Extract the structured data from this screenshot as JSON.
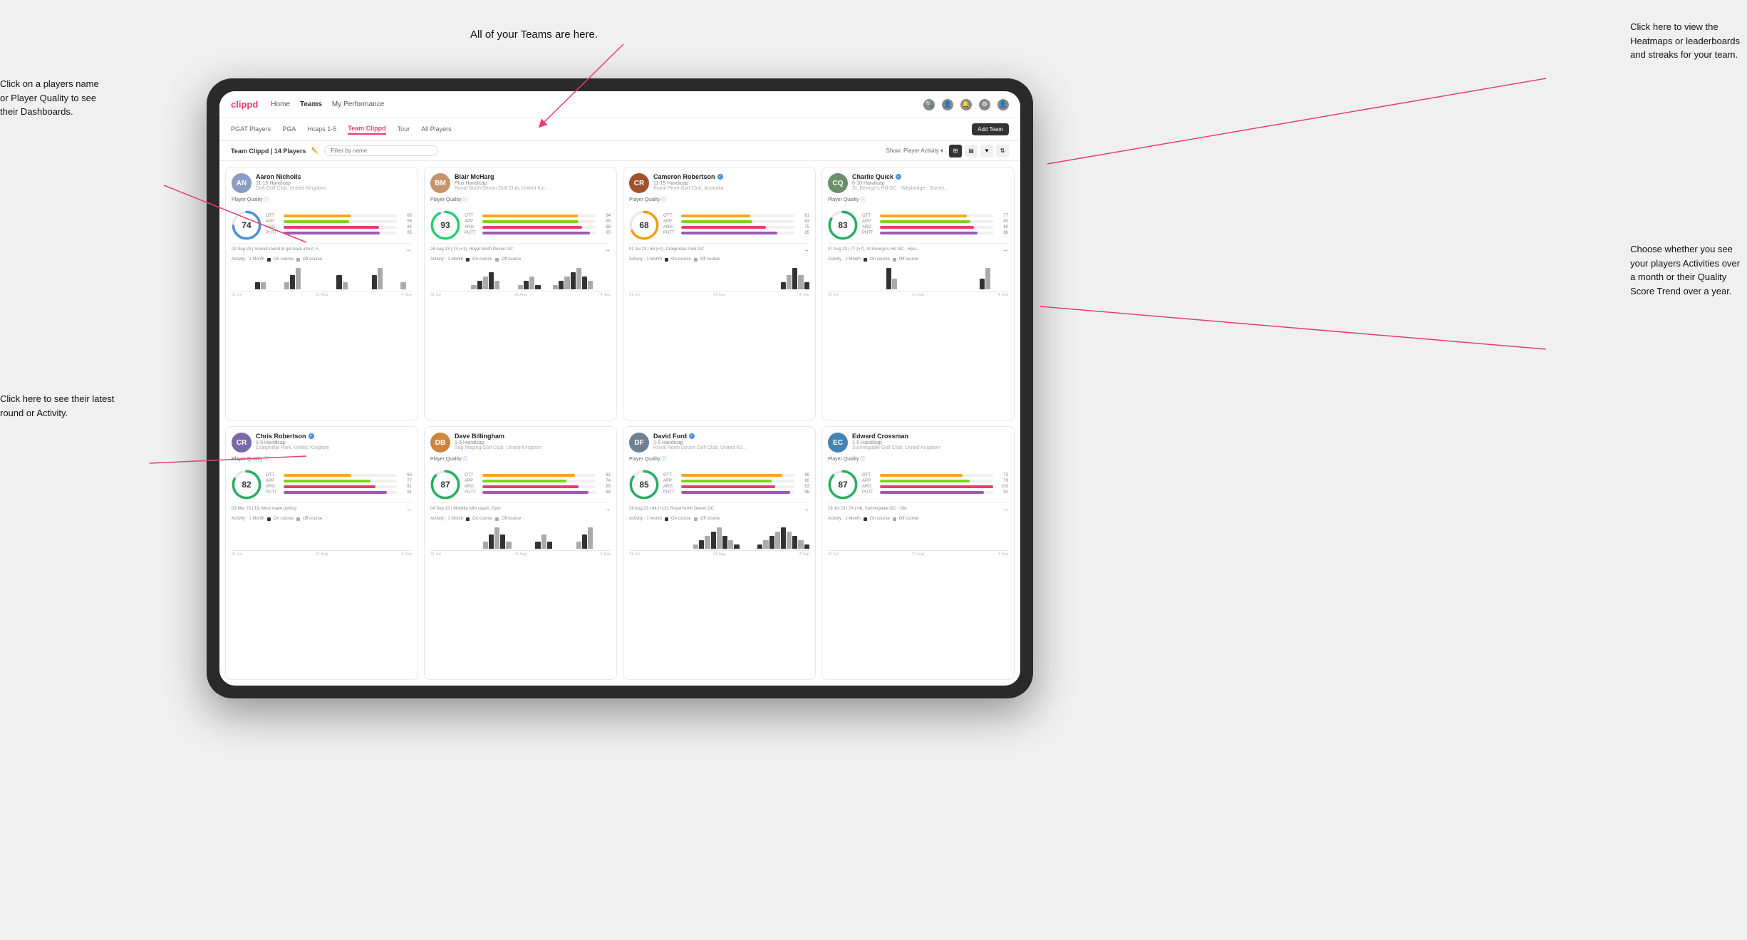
{
  "annotations": {
    "teams_callout": "All of your Teams are here.",
    "heatmaps_callout": "Click here to view the\nHeatmaps or leaderboards\nand streaks for your team.",
    "players_name_callout": "Click on a players name\nor Player Quality to see\ntheir Dashboards.",
    "latest_round_callout": "Click here to see their latest\nround or Activity.",
    "activities_callout": "Choose whether you see\nyour players Activities over\na month or their Quality\nScore Trend over a year."
  },
  "nav": {
    "logo": "clippd",
    "links": [
      "Home",
      "Teams",
      "My Performance"
    ],
    "active_link": "Teams"
  },
  "sub_nav": {
    "links": [
      "PGAT Players",
      "PGA",
      "Hcaps 1-5",
      "Team Clippd",
      "Tour",
      "All Players"
    ],
    "active": "Team Clippd",
    "add_team_label": "Add Team"
  },
  "team_header": {
    "title": "Team Clippd | 14 Players",
    "filter_placeholder": "Filter by name",
    "show_label": "Show:",
    "show_value": "Player Activity"
  },
  "players": [
    {
      "name": "Aaron Nicholls",
      "handicap": "11-15 Handicap",
      "club": "Drift Golf Club, United Kingdom",
      "verified": false,
      "quality": 74,
      "quality_color": "#4a90d9",
      "stats": [
        {
          "label": "OTT",
          "value": 60,
          "color": "#f5a623"
        },
        {
          "label": "APP",
          "value": 58,
          "color": "#7ed321"
        },
        {
          "label": "ARG",
          "value": 84,
          "color": "#e83e6c"
        },
        {
          "label": "PUTT",
          "value": 85,
          "color": "#9b59b6"
        }
      ],
      "latest_round": "02 Sep 23 | Sunset round to get back into it, F...",
      "avatar_color": "#8B9DC3",
      "avatar_initials": "AN"
    },
    {
      "name": "Blair McHarg",
      "handicap": "Plus Handicap",
      "club": "Royal North Devon Golf Club, United Kin...",
      "verified": false,
      "quality": 93,
      "quality_color": "#2ecc71",
      "stats": [
        {
          "label": "OTT",
          "value": 84,
          "color": "#f5a623"
        },
        {
          "label": "APP",
          "value": 85,
          "color": "#7ed321"
        },
        {
          "label": "ARG",
          "value": 88,
          "color": "#e83e6c"
        },
        {
          "label": "PUTT",
          "value": 95,
          "color": "#9b59b6"
        }
      ],
      "latest_round": "26 Aug 23 | 73 (+1), Royal North Devon GC",
      "avatar_color": "#C4956A",
      "avatar_initials": "BM"
    },
    {
      "name": "Cameron Robertson",
      "handicap": "11-15 Handicap",
      "club": "Royal Perth Golf Club, Australia",
      "verified": true,
      "quality": 68,
      "quality_color": "#f39c12",
      "stats": [
        {
          "label": "OTT",
          "value": 61,
          "color": "#f5a623"
        },
        {
          "label": "APP",
          "value": 63,
          "color": "#7ed321"
        },
        {
          "label": "ARG",
          "value": 75,
          "color": "#e83e6c"
        },
        {
          "label": "PUTT",
          "value": 85,
          "color": "#9b59b6"
        }
      ],
      "latest_round": "02 Jul 23 | 59 (+1), Craigmillar Park GC",
      "avatar_color": "#A0522D",
      "avatar_initials": "CR"
    },
    {
      "name": "Charlie Quick",
      "handicap": "6-10 Handicap",
      "club": "St. George's Hill GC - Weybridge - Surrey...",
      "verified": true,
      "quality": 83,
      "quality_color": "#27ae60",
      "stats": [
        {
          "label": "OTT",
          "value": 77,
          "color": "#f5a623"
        },
        {
          "label": "APP",
          "value": 80,
          "color": "#7ed321"
        },
        {
          "label": "ARG",
          "value": 83,
          "color": "#e83e6c"
        },
        {
          "label": "PUTT",
          "value": 86,
          "color": "#9b59b6"
        }
      ],
      "latest_round": "07 Aug 23 | 77 (+7), St George's Hill GC - Red...",
      "avatar_color": "#6B8E6B",
      "avatar_initials": "CQ"
    },
    {
      "name": "Chris Robertson",
      "handicap": "1-5 Handicap",
      "club": "Craigmillar Park, United Kingdom",
      "verified": true,
      "quality": 82,
      "quality_color": "#27ae60",
      "stats": [
        {
          "label": "OTT",
          "value": 60,
          "color": "#f5a623"
        },
        {
          "label": "APP",
          "value": 77,
          "color": "#7ed321"
        },
        {
          "label": "ARG",
          "value": 81,
          "color": "#e83e6c"
        },
        {
          "label": "PUTT",
          "value": 91,
          "color": "#9b59b6"
        }
      ],
      "latest_round": "03 Mar 23 | 19, Must make putting",
      "avatar_color": "#7B68AA",
      "avatar_initials": "CR"
    },
    {
      "name": "Dave Billingham",
      "handicap": "1-5 Handicap",
      "club": "Sag Maging Golf Club, United Kingdom",
      "verified": false,
      "quality": 87,
      "quality_color": "#27ae60",
      "stats": [
        {
          "label": "OTT",
          "value": 82,
          "color": "#f5a623"
        },
        {
          "label": "APP",
          "value": 74,
          "color": "#7ed321"
        },
        {
          "label": "ARG",
          "value": 85,
          "color": "#e83e6c"
        },
        {
          "label": "PUTT",
          "value": 94,
          "color": "#9b59b6"
        }
      ],
      "latest_round": "04 Sep 23 | Mobility with coach, Gym",
      "avatar_color": "#CD853F",
      "avatar_initials": "DB"
    },
    {
      "name": "David Ford",
      "handicap": "1-5 Handicap",
      "club": "Royal North Devon Golf Club, United Kil...",
      "verified": true,
      "quality": 85,
      "quality_color": "#27ae60",
      "stats": [
        {
          "label": "OTT",
          "value": 89,
          "color": "#f5a623"
        },
        {
          "label": "APP",
          "value": 80,
          "color": "#7ed321"
        },
        {
          "label": "ARG",
          "value": 83,
          "color": "#e83e6c"
        },
        {
          "label": "PUTT",
          "value": 96,
          "color": "#9b59b6"
        }
      ],
      "latest_round": "26 Aug 23 | 84 (+12), Royal North Devon GC",
      "avatar_color": "#708090",
      "avatar_initials": "DF"
    },
    {
      "name": "Edward Crossman",
      "handicap": "1-5 Handicap",
      "club": "Sunningdale Golf Club, United Kingdom",
      "verified": false,
      "quality": 87,
      "quality_color": "#27ae60",
      "stats": [
        {
          "label": "OTT",
          "value": 73,
          "color": "#f5a623"
        },
        {
          "label": "APP",
          "value": 79,
          "color": "#7ed321"
        },
        {
          "label": "ARG",
          "value": 103,
          "color": "#e83e6c"
        },
        {
          "label": "PUTT",
          "value": 92,
          "color": "#9b59b6"
        }
      ],
      "latest_round": "18 Jul 23 | 74 (+4), Sunningdale GC - Old",
      "avatar_color": "#4682B4",
      "avatar_initials": "EC"
    }
  ],
  "chart": {
    "activity_label": "Activity · 1 Month",
    "on_course_label": "On course",
    "off_course_label": "Off course",
    "on_course_color": "#333333",
    "off_course_color": "#aaaaaa",
    "dates": [
      "31 Jul",
      "21 Aug",
      "4 Sep"
    ]
  }
}
